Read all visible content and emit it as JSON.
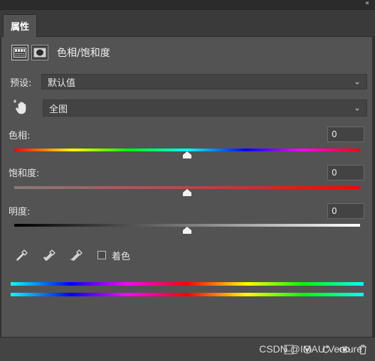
{
  "panel": {
    "tab_label": "属性",
    "title": "色相/饱和度",
    "collapse_glyph": "«"
  },
  "preset": {
    "label": "预设:",
    "value": "默认值"
  },
  "channel": {
    "value": "全图"
  },
  "hue": {
    "label": "色相:",
    "value": "0",
    "level": 0.5
  },
  "saturation": {
    "label": "饱和度:",
    "value": "0",
    "level": 0.5
  },
  "lightness": {
    "label": "明度:",
    "value": "0",
    "level": 0.5
  },
  "colorize": {
    "label": "着色",
    "checked": false
  },
  "icons": {
    "adjustment": "hue-saturation-layer-icon",
    "mask": "layer-mask-icon",
    "targeted": "targeted-adjustment-hand-icon",
    "eyedropper": "eyedropper-icon",
    "eyedropper_add": "eyedropper-add-icon",
    "eyedropper_subtract": "eyedropper-subtract-icon",
    "chevron": "chevron-down-icon"
  },
  "footer": {
    "watermark": "CSDN @IMAU Venture"
  },
  "colors": {
    "panel_bg": "#535353",
    "chrome_bg": "#323232",
    "field_bg": "#434343"
  }
}
